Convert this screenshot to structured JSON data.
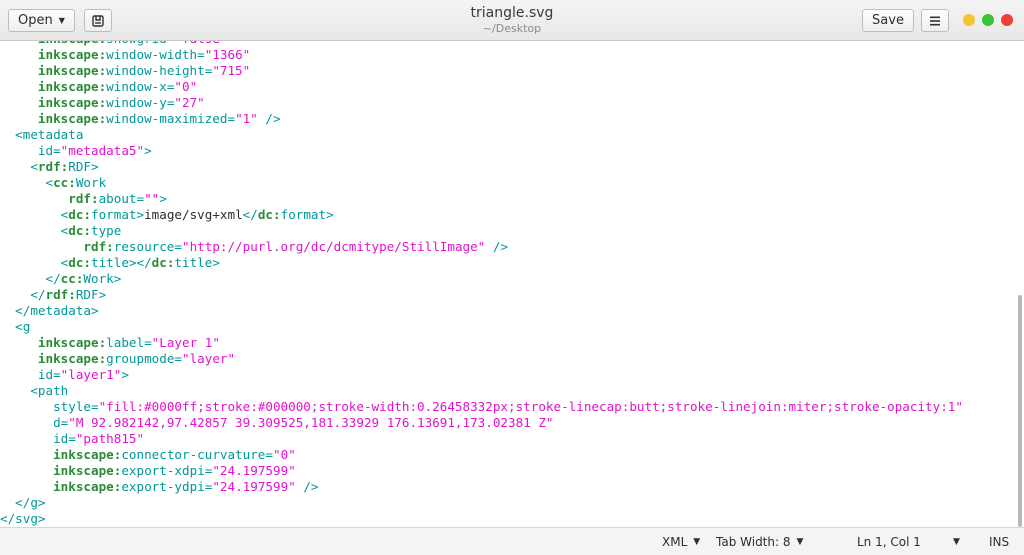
{
  "header": {
    "open_label": "Open",
    "docs_icon": "documents-icon",
    "title": "triangle.svg",
    "subtitle": "~/Desktop",
    "save_label": "Save",
    "menu_icon": "hamburger-icon",
    "window_controls": {
      "minimize_color": "#f4c430",
      "maximize_color": "#3cc13b",
      "close_color": "#ef4036"
    }
  },
  "editor": {
    "lines": [
      [
        {
          "c": "ns",
          "t": "     inkscape:"
        },
        {
          "c": "attr",
          "t": "showgrid="
        },
        {
          "c": "str",
          "t": "\"false\""
        }
      ],
      [
        {
          "c": "ns",
          "t": "     inkscape:"
        },
        {
          "c": "attr",
          "t": "window-width="
        },
        {
          "c": "str",
          "t": "\"1366\""
        }
      ],
      [
        {
          "c": "ns",
          "t": "     inkscape:"
        },
        {
          "c": "attr",
          "t": "window-height="
        },
        {
          "c": "str",
          "t": "\"715\""
        }
      ],
      [
        {
          "c": "ns",
          "t": "     inkscape:"
        },
        {
          "c": "attr",
          "t": "window-x="
        },
        {
          "c": "str",
          "t": "\"0\""
        }
      ],
      [
        {
          "c": "ns",
          "t": "     inkscape:"
        },
        {
          "c": "attr",
          "t": "window-y="
        },
        {
          "c": "str",
          "t": "\"27\""
        }
      ],
      [
        {
          "c": "ns",
          "t": "     inkscape:"
        },
        {
          "c": "attr",
          "t": "window-maximized="
        },
        {
          "c": "str",
          "t": "\"1\""
        },
        {
          "c": "tag",
          "t": " />"
        }
      ],
      [
        {
          "c": "tag",
          "t": "  <metadata"
        }
      ],
      [
        {
          "c": "attr",
          "t": "     id="
        },
        {
          "c": "str",
          "t": "\"metadata5\""
        },
        {
          "c": "tag",
          "t": ">"
        }
      ],
      [
        {
          "c": "tag",
          "t": "    <"
        },
        {
          "c": "ns",
          "t": "rdf:"
        },
        {
          "c": "tag",
          "t": "RDF>"
        }
      ],
      [
        {
          "c": "tag",
          "t": "      <"
        },
        {
          "c": "ns",
          "t": "cc:"
        },
        {
          "c": "tag",
          "t": "Work"
        }
      ],
      [
        {
          "c": "ns",
          "t": "         rdf:"
        },
        {
          "c": "attr",
          "t": "about="
        },
        {
          "c": "str",
          "t": "\"\""
        },
        {
          "c": "tag",
          "t": ">"
        }
      ],
      [
        {
          "c": "tag",
          "t": "        <"
        },
        {
          "c": "ns",
          "t": "dc:"
        },
        {
          "c": "tag",
          "t": "format>"
        },
        {
          "c": "txt",
          "t": "image/svg+xml"
        },
        {
          "c": "tag",
          "t": "</"
        },
        {
          "c": "ns",
          "t": "dc:"
        },
        {
          "c": "tag",
          "t": "format>"
        }
      ],
      [
        {
          "c": "tag",
          "t": "        <"
        },
        {
          "c": "ns",
          "t": "dc:"
        },
        {
          "c": "tag",
          "t": "type"
        }
      ],
      [
        {
          "c": "ns",
          "t": "           rdf:"
        },
        {
          "c": "attr",
          "t": "resource="
        },
        {
          "c": "str",
          "t": "\"http://purl.org/dc/dcmitype/StillImage\""
        },
        {
          "c": "tag",
          "t": " />"
        }
      ],
      [
        {
          "c": "tag",
          "t": "        <"
        },
        {
          "c": "ns",
          "t": "dc:"
        },
        {
          "c": "tag",
          "t": "title></"
        },
        {
          "c": "ns",
          "t": "dc:"
        },
        {
          "c": "tag",
          "t": "title>"
        }
      ],
      [
        {
          "c": "tag",
          "t": "      </"
        },
        {
          "c": "ns",
          "t": "cc:"
        },
        {
          "c": "tag",
          "t": "Work>"
        }
      ],
      [
        {
          "c": "tag",
          "t": "    </"
        },
        {
          "c": "ns",
          "t": "rdf:"
        },
        {
          "c": "tag",
          "t": "RDF>"
        }
      ],
      [
        {
          "c": "tag",
          "t": "  </metadata>"
        }
      ],
      [
        {
          "c": "tag",
          "t": "  <g"
        }
      ],
      [
        {
          "c": "ns",
          "t": "     inkscape:"
        },
        {
          "c": "attr",
          "t": "label="
        },
        {
          "c": "str",
          "t": "\"Layer 1\""
        }
      ],
      [
        {
          "c": "ns",
          "t": "     inkscape:"
        },
        {
          "c": "attr",
          "t": "groupmode="
        },
        {
          "c": "str",
          "t": "\"layer\""
        }
      ],
      [
        {
          "c": "attr",
          "t": "     id="
        },
        {
          "c": "str",
          "t": "\"layer1\""
        },
        {
          "c": "tag",
          "t": ">"
        }
      ],
      [
        {
          "c": "tag",
          "t": "    <path"
        }
      ],
      [
        {
          "c": "attr",
          "t": "       style="
        },
        {
          "c": "str",
          "t": "\"fill:#0000ff;stroke:#000000;stroke-width:0.26458332px;stroke-linecap:butt;stroke-linejoin:miter;stroke-opacity:1\""
        }
      ],
      [
        {
          "c": "attr",
          "t": "       d="
        },
        {
          "c": "str",
          "t": "\"M 92.982142,97.42857 39.309525,181.33929 176.13691,173.02381 Z\""
        }
      ],
      [
        {
          "c": "attr",
          "t": "       id="
        },
        {
          "c": "str",
          "t": "\"path815\""
        }
      ],
      [
        {
          "c": "ns",
          "t": "       inkscape:"
        },
        {
          "c": "attr",
          "t": "connector-curvature="
        },
        {
          "c": "str",
          "t": "\"0\""
        }
      ],
      [
        {
          "c": "ns",
          "t": "       inkscape:"
        },
        {
          "c": "attr",
          "t": "export-xdpi="
        },
        {
          "c": "str",
          "t": "\"24.197599\""
        }
      ],
      [
        {
          "c": "ns",
          "t": "       inkscape:"
        },
        {
          "c": "attr",
          "t": "export-ydpi="
        },
        {
          "c": "str",
          "t": "\"24.197599\""
        },
        {
          "c": "tag",
          "t": " />"
        }
      ],
      [
        {
          "c": "tag",
          "t": "  </g>"
        }
      ],
      [
        {
          "c": "tag",
          "t": "</svg>"
        }
      ]
    ]
  },
  "statusbar": {
    "language": "XML",
    "tab_width": "Tab Width: 8",
    "position": "Ln 1, Col 1",
    "insert_mode": "INS"
  }
}
